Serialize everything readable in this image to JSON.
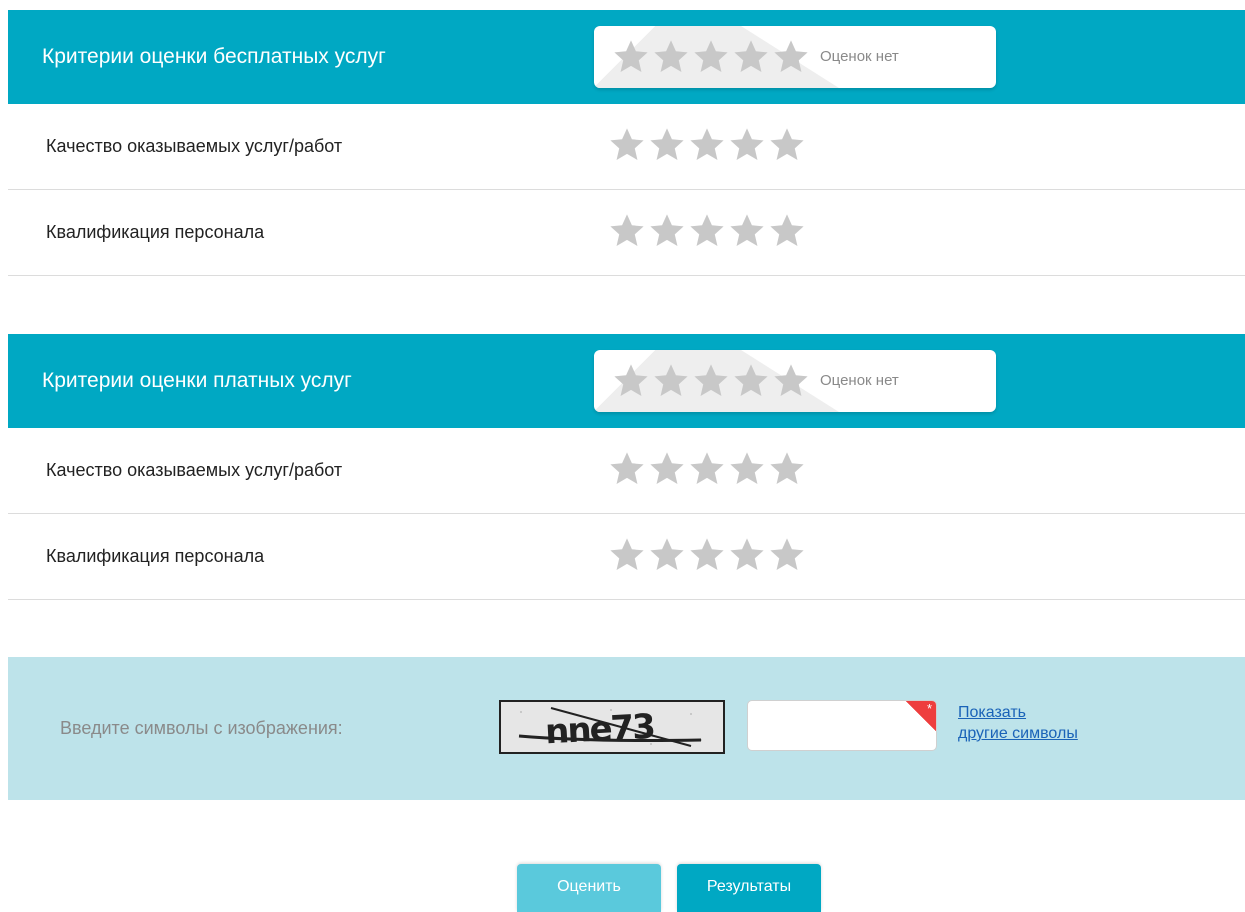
{
  "sections": [
    {
      "title": "Критерии оценки бесплатных услуг",
      "summary": {
        "text": "Оценок нет",
        "stars": 5,
        "rating": 0
      },
      "rows": [
        {
          "label": "Качество оказываемых услуг/работ",
          "stars": 5,
          "rating": 0
        },
        {
          "label": "Квалификация персонала",
          "stars": 5,
          "rating": 0
        }
      ]
    },
    {
      "title": "Критерии оценки платных услуг",
      "summary": {
        "text": "Оценок нет",
        "stars": 5,
        "rating": 0
      },
      "rows": [
        {
          "label": "Качество оказываемых услуг/работ",
          "stars": 5,
          "rating": 0
        },
        {
          "label": "Квалификация персонала",
          "stars": 5,
          "rating": 0
        }
      ]
    }
  ],
  "captcha": {
    "label": "Введите символы с изображения:",
    "image_text": "nne73",
    "input_value": "",
    "required_mark": "*",
    "refresh_link_line1": "Показать",
    "refresh_link_line2": "другие символы"
  },
  "buttons": {
    "rate_label": "Оценить",
    "results_label": "Результаты"
  },
  "colors": {
    "header_bg": "#00a8c3",
    "star_empty": "#c8c8c8",
    "captcha_bg": "#bde3ea",
    "required_corner": "#ee3e3e",
    "link": "#1a63b8"
  },
  "icons": {
    "star": "star-icon"
  }
}
